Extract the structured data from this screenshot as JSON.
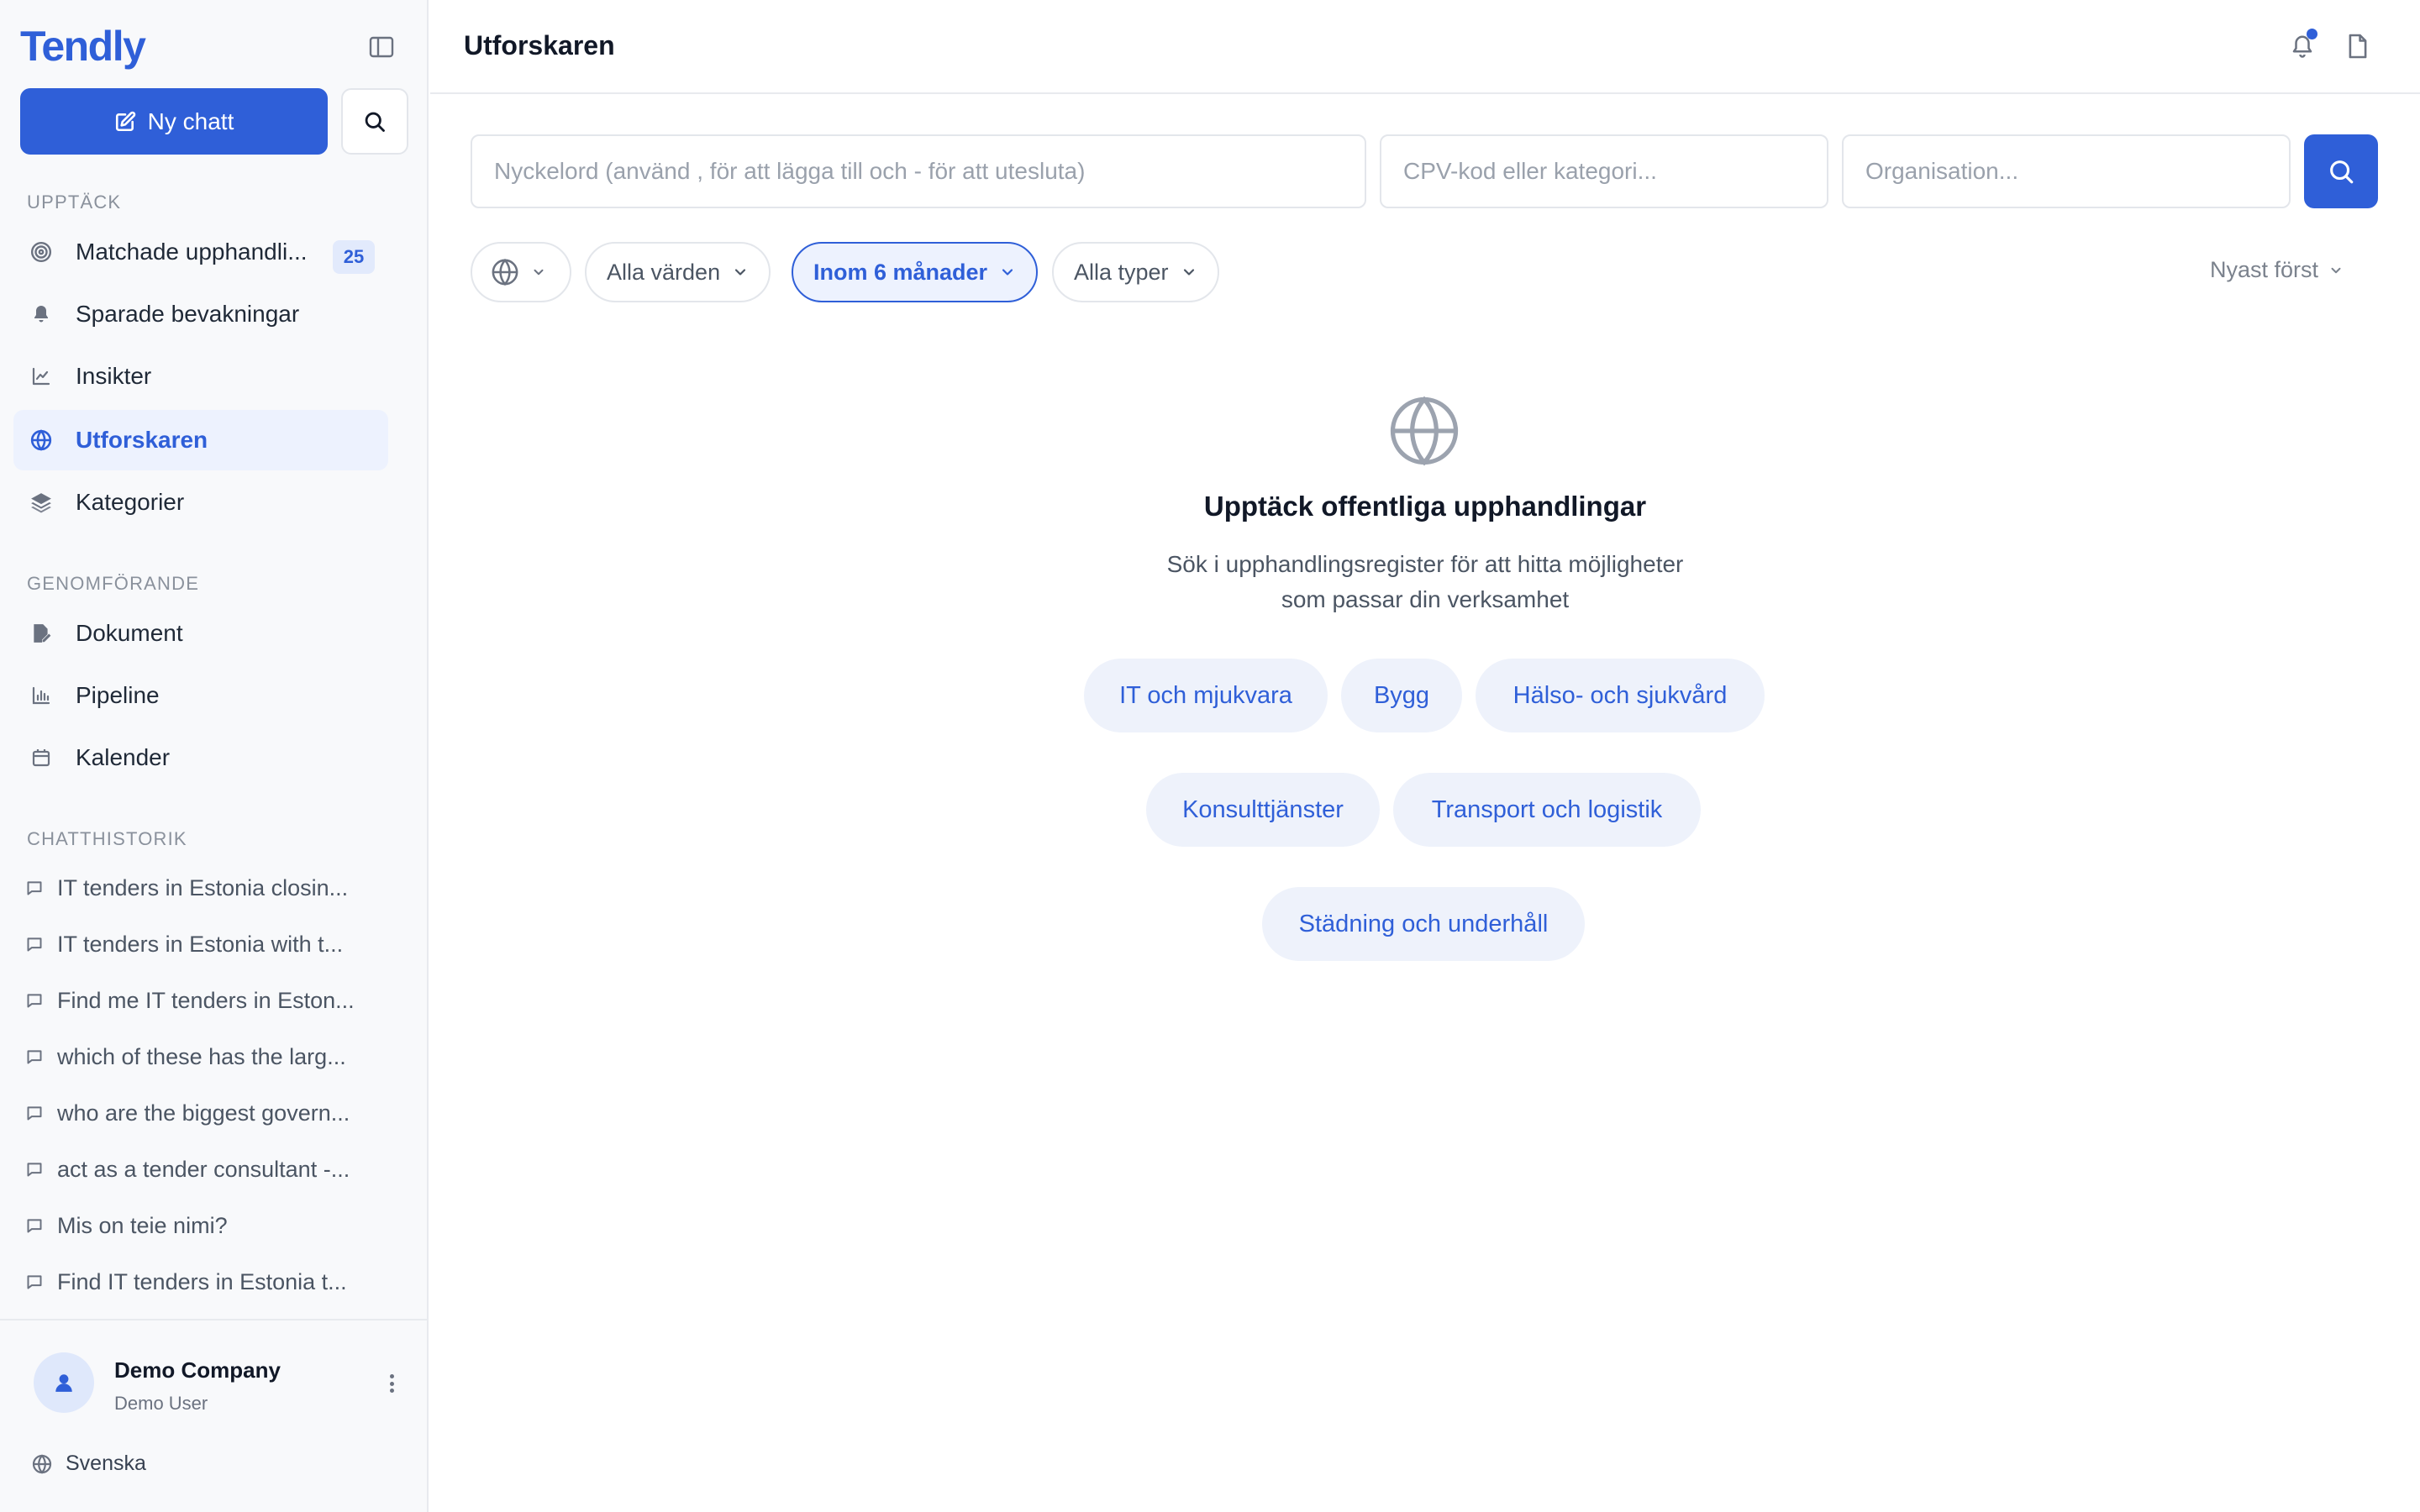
{
  "app": {
    "logo": "Tendly"
  },
  "sidebar": {
    "new_chat_label": "Ny chatt",
    "sections": {
      "discover": "UPPTÄCK",
      "execution": "GENOMFÖRANDE",
      "history": "CHATTHISTORIK"
    },
    "discover_items": [
      {
        "label": "Matchade upphandli...",
        "icon": "target-icon",
        "badge": "25"
      },
      {
        "label": "Sparade bevakningar",
        "icon": "bell-icon"
      },
      {
        "label": "Insikter",
        "icon": "line-chart-icon"
      },
      {
        "label": "Utforskaren",
        "icon": "globe-icon",
        "active": true
      },
      {
        "label": "Kategorier",
        "icon": "layers-icon"
      }
    ],
    "execution_items": [
      {
        "label": "Dokument",
        "icon": "file-edit-icon"
      },
      {
        "label": "Pipeline",
        "icon": "bar-chart-icon"
      },
      {
        "label": "Kalender",
        "icon": "calendar-icon"
      }
    ],
    "chat_history": [
      "IT tenders in Estonia closin...",
      "IT tenders in Estonia with t...",
      "Find me IT tenders in Eston...",
      "which of these has the larg...",
      "who are the biggest govern...",
      "act as a tender consultant -...",
      "Mis on teie nimi?",
      "Find IT tenders in Estonia t..."
    ],
    "footer": {
      "company": "Demo Company",
      "user": "Demo User",
      "language": "Svenska"
    }
  },
  "header": {
    "title": "Utforskaren"
  },
  "search": {
    "keyword_placeholder": "Nyckelord (använd , för att lägga till och - för att utesluta)",
    "cpv_placeholder": "CPV-kod eller kategori...",
    "org_placeholder": "Organisation..."
  },
  "filters": {
    "value": "Alla värden",
    "period": "Inom 6 månader",
    "type": "Alla typer",
    "sort": "Nyast först"
  },
  "empty_state": {
    "title": "Upptäck offentliga upphandlingar",
    "subtitle_line1": "Sök i upphandlingsregister för att hitta möjligheter",
    "subtitle_line2": "som passar din verksamhet",
    "chips": [
      "IT och mjukvara",
      "Bygg",
      "Hälso- och sjukvård",
      "Konsulttjänster",
      "Transport och logistik",
      "Städning och underhåll"
    ]
  },
  "colors": {
    "accent": "#2f5fd8",
    "active_bg": "#edf2fe",
    "sidebar_bg": "#f8f9fb"
  }
}
